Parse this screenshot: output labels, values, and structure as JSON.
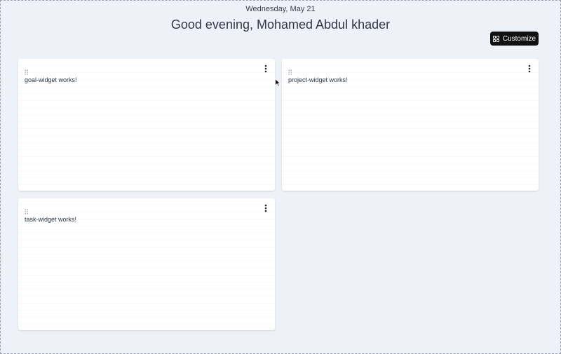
{
  "header": {
    "date": "Wednesday, May 21",
    "greeting": "Good evening, Mohamed Abdul khader"
  },
  "toolbar": {
    "customize_label": "Customize",
    "customize_icon": "grid-icon"
  },
  "widgets": [
    {
      "label": "goal-widget works!"
    },
    {
      "label": "project-widget works!"
    },
    {
      "label": "task-widget works!"
    }
  ],
  "icons": {
    "drag": "drag-handle-icon",
    "menu": "more-vertical-icon"
  },
  "colors": {
    "background": "#eef1f7",
    "button": "#111111",
    "card": "#ffffff"
  }
}
